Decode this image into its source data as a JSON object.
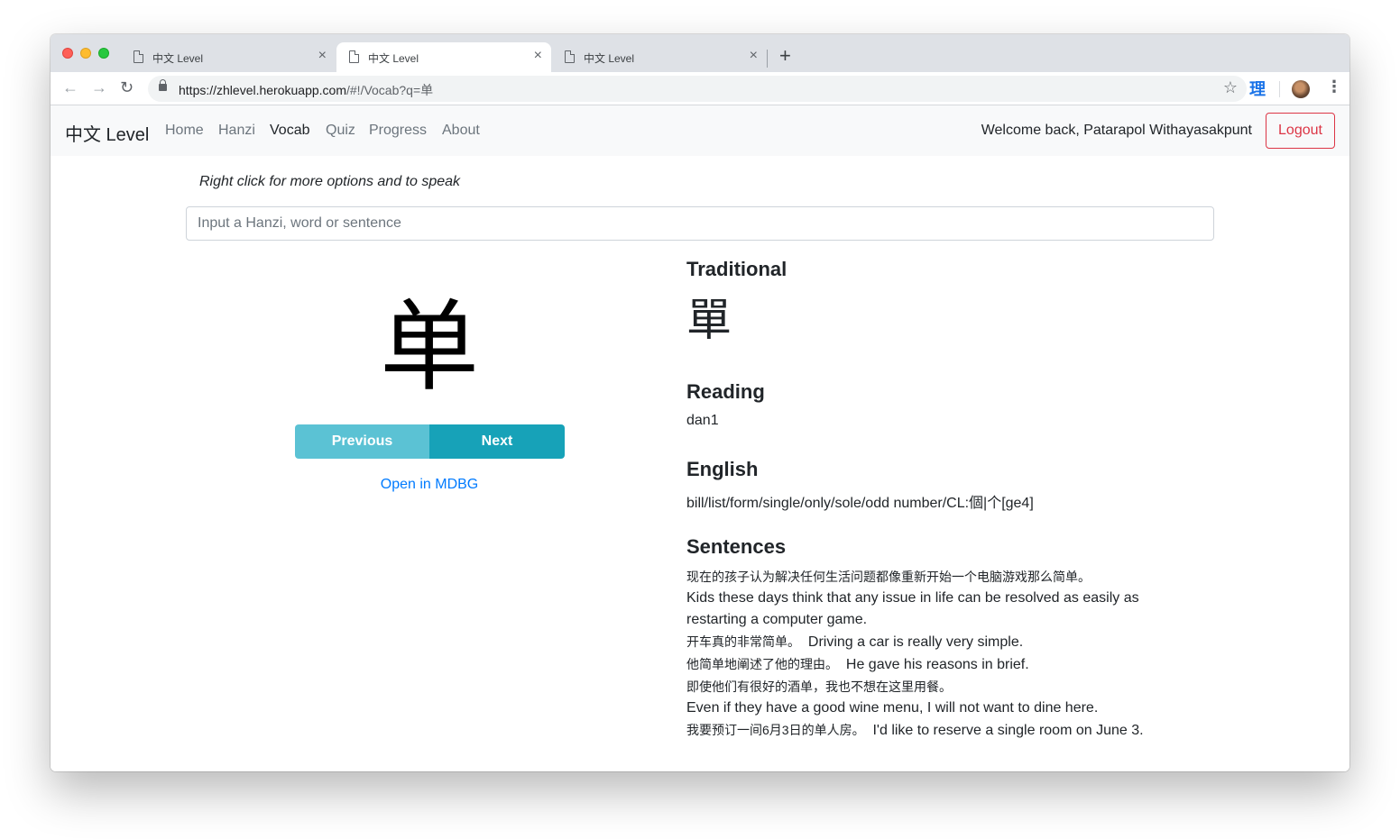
{
  "browser": {
    "tabs": [
      {
        "title": "中文 Level",
        "active": false
      },
      {
        "title": "中文 Level",
        "active": true
      },
      {
        "title": "中文 Level",
        "active": false
      }
    ],
    "tab_close": "×",
    "new_tab": "+",
    "url_main": "https://zhlevel.herokuapp.com",
    "url_rest": "/#!/Vocab?q=单",
    "extension_label": "理",
    "icons": {
      "back": "←",
      "forward": "→",
      "reload": "↻",
      "star": "☆",
      "menu": "⋮"
    }
  },
  "navbar": {
    "brand": "中文 Level",
    "links": [
      "Home",
      "Hanzi",
      "Vocab",
      "Quiz",
      "Progress",
      "About"
    ],
    "active_link": "Vocab",
    "welcome": "Welcome back, Patarapol Withayasakpunt",
    "logout": "Logout"
  },
  "vocab": {
    "hint": "Right click for more options and to speak",
    "search_placeholder": "Input a Hanzi, word or sentence",
    "simplified": "单",
    "previous": "Previous",
    "next": "Next",
    "mdbg_link": "Open in MDBG",
    "traditional_heading": "Traditional",
    "traditional": "單",
    "reading_heading": "Reading",
    "reading": "dan1",
    "english_heading": "English",
    "english": "bill/list/form/single/only/sole/odd number/CL:個|个[ge4]",
    "sentences_heading": "Sentences",
    "sentences": [
      {
        "zh": "现在的孩子认为解决任何生活问题都像重新开始一个电脑游戏那么简单。",
        "en": "Kids these days think that any issue in life can be resolved as easily as restarting a computer game.",
        "inline": false
      },
      {
        "zh": "开车真的非常简单。",
        "en": "Driving a car is really very simple.",
        "inline": true
      },
      {
        "zh": "他简单地阐述了他的理由。",
        "en": "He gave his reasons in brief.",
        "inline": true
      },
      {
        "zh": "即使他们有很好的酒单，我也不想在这里用餐。",
        "en": "Even if they have a good wine menu, I will not want to dine here.",
        "inline": false
      },
      {
        "zh": "我要预订一间6月3日的单人房。",
        "en": "I'd like to reserve a single room on June 3.",
        "inline": true
      }
    ]
  },
  "colors": {
    "primary_link": "#007bff",
    "info": "#17a2b8",
    "info_light": "#5bc2d4",
    "danger": "#dc3545"
  }
}
